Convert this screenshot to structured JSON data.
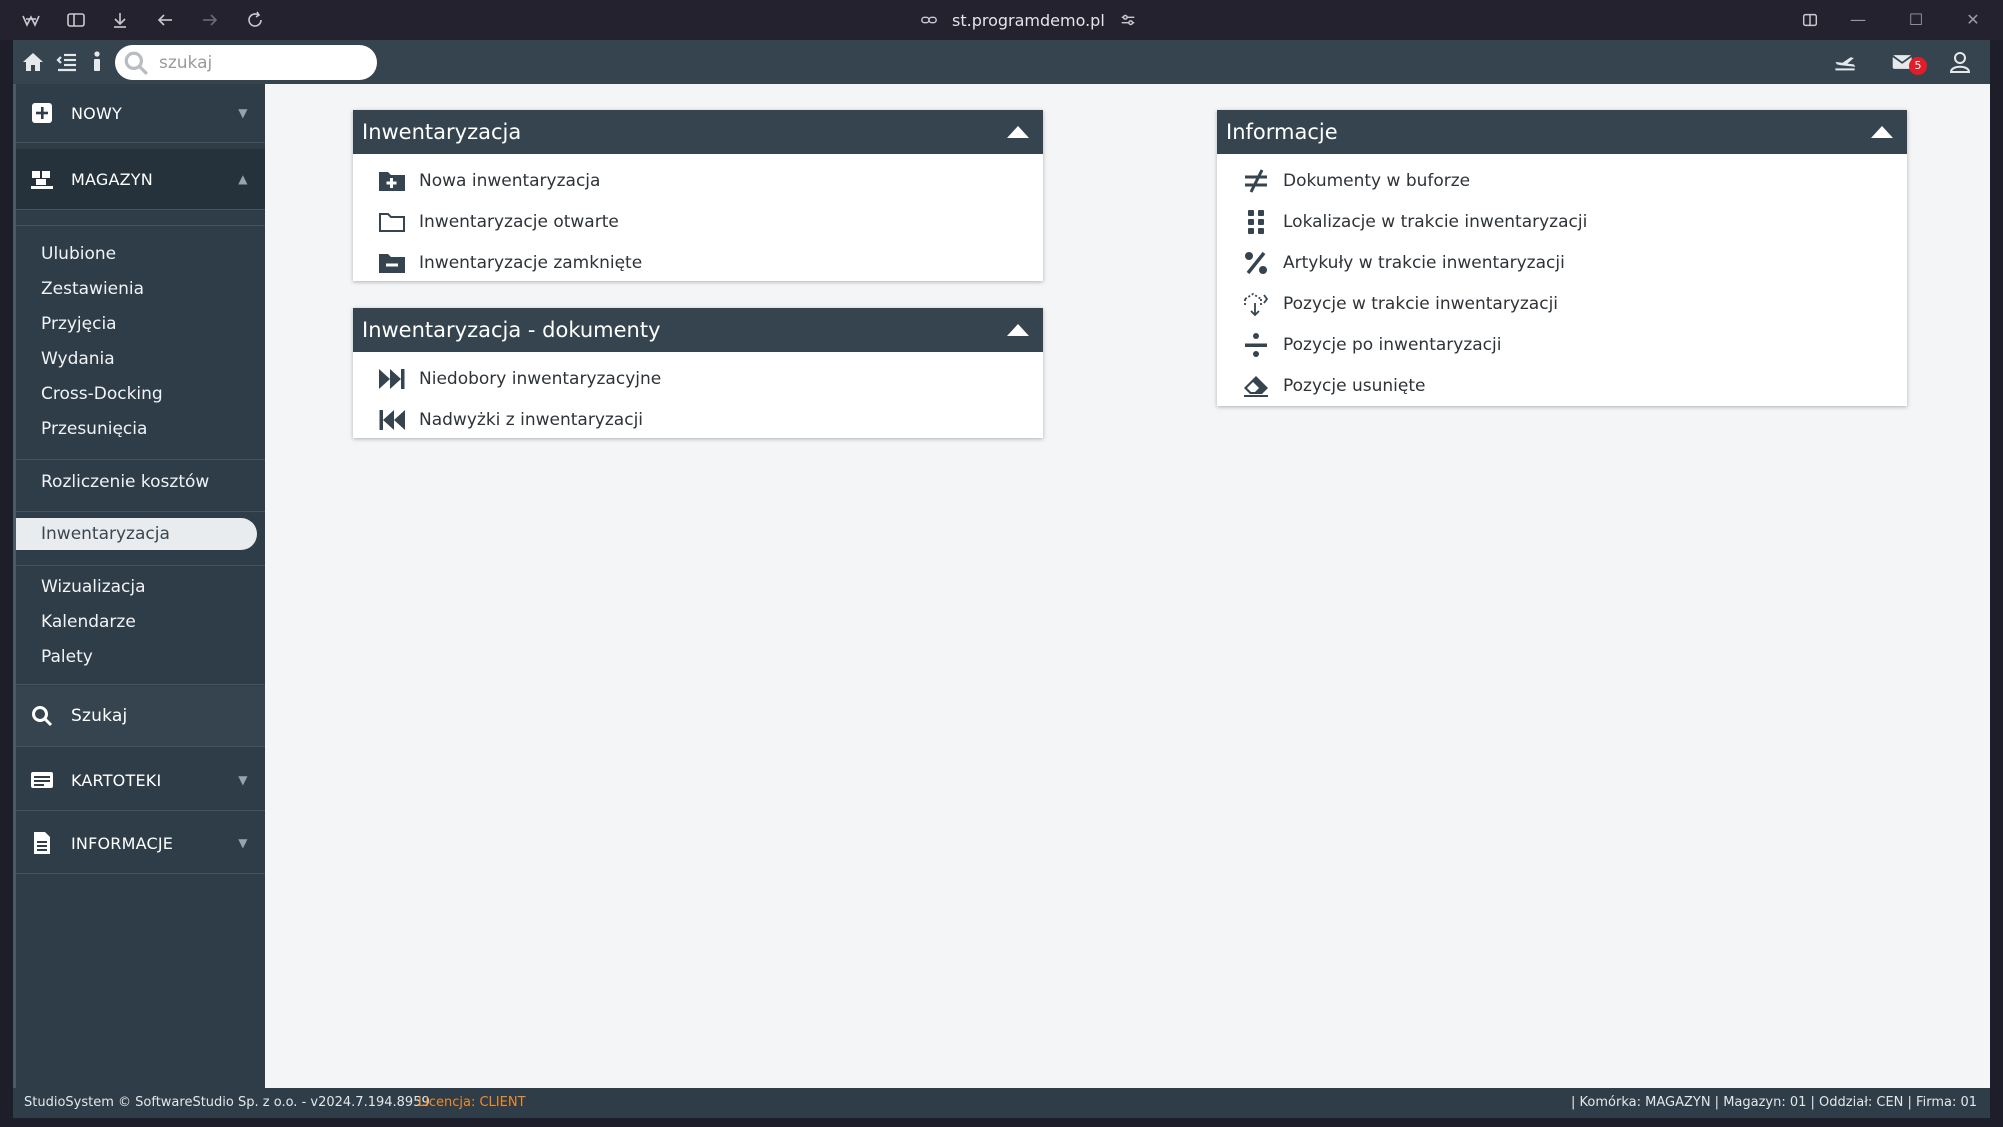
{
  "browser": {
    "url": "st.programdemo.pl"
  },
  "topbar": {
    "search_placeholder": "szukaj",
    "mail_count": "5"
  },
  "sidebar": {
    "new_label": "NOWY",
    "magazyn_label": "MAGAZYN",
    "links": {
      "ulubione": "Ulubione",
      "zestawienia": "Zestawienia",
      "przyjecia": "Przyjęcia",
      "wydania": "Wydania",
      "crossdocking": "Cross-Docking",
      "przesuniecia": "Przesunięcia",
      "rozliczenie": "Rozliczenie kosztów",
      "inwentaryzacja": "Inwentaryzacja",
      "wizualizacja": "Wizualizacja",
      "kalendarze": "Kalendarze",
      "palety": "Palety"
    },
    "szukaj_label": "Szukaj",
    "kartoteki_label": "KARTOTEKI",
    "informacje_label": "INFORMACJE"
  },
  "panels": {
    "inwentaryzacja": {
      "title": "Inwentaryzacja",
      "items": [
        "Nowa inwentaryzacja",
        "Inwentaryzacje otwarte",
        "Inwentaryzacje zamknięte"
      ]
    },
    "dokumenty": {
      "title": "Inwentaryzacja - dokumenty",
      "items": [
        "Niedobory inwentaryzacyjne",
        "Nadwyżki z inwentaryzacji"
      ]
    },
    "informacje": {
      "title": "Informacje",
      "items": [
        "Dokumenty w buforze",
        "Lokalizacje w trakcie inwentaryzacji",
        "Artykuły w trakcie inwentaryzacji",
        "Pozycje w trakcie inwentaryzacji",
        "Pozycje po inwentaryzacji",
        "Pozycje usunięte"
      ]
    }
  },
  "footer": {
    "copyright": "StudioSystem © SoftwareStudio Sp. z o.o. - v2024.7.194.8959",
    "license": "Licencja: CLIENT",
    "context": "| Komórka: MAGAZYN | Magazyn: 01 | Oddział: CEN | Firma: 01"
  },
  "colors": {
    "header_bg": "#35444f",
    "sidebar_bg": "#2f3d48",
    "license_text": "#f08a2c",
    "badge": "#e21d2a"
  }
}
